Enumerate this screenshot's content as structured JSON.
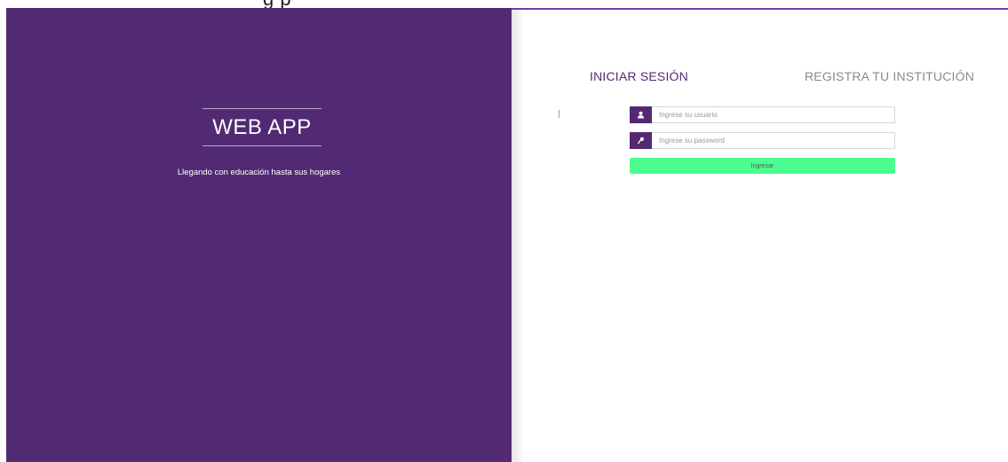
{
  "page": {
    "top_caption": "g    p"
  },
  "brand": {
    "title": "WEB APP",
    "tagline": "Llegando con educación hasta sus hogares"
  },
  "tabs": {
    "login": "INICIAR SESIÓN",
    "register": "REGISTRA TU INSTITUCIÓN"
  },
  "form": {
    "username_placeholder": "Ingrese su usuario",
    "username_value": "",
    "password_placeholder": "Ingrese su password",
    "password_value": "",
    "submit_label": "Ingresar"
  },
  "icons": {
    "user": "user-icon",
    "key": "key-icon"
  },
  "colors": {
    "brand_purple": "#522a73",
    "accent_green": "#4cfd8f",
    "inactive_text": "#8a8a8a"
  }
}
